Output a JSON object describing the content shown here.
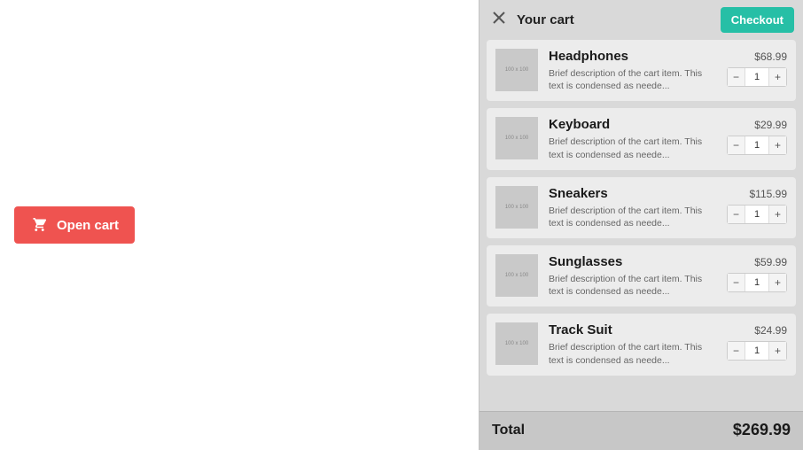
{
  "main": {
    "open_cart_label": "Open cart"
  },
  "cart": {
    "title": "Your cart",
    "checkout_label": "Checkout",
    "thumb_placeholder": "100 x 100",
    "item_description": "Brief description of the cart item. This text is condensed as neede...",
    "items": [
      {
        "name": "Headphones",
        "price": "$68.99",
        "qty": "1"
      },
      {
        "name": "Keyboard",
        "price": "$29.99",
        "qty": "1"
      },
      {
        "name": "Sneakers",
        "price": "$115.99",
        "qty": "1"
      },
      {
        "name": "Sunglasses",
        "price": "$59.99",
        "qty": "1"
      },
      {
        "name": "Track Suit",
        "price": "$24.99",
        "qty": "1"
      }
    ],
    "total_label": "Total",
    "total_value": "$269.99"
  }
}
